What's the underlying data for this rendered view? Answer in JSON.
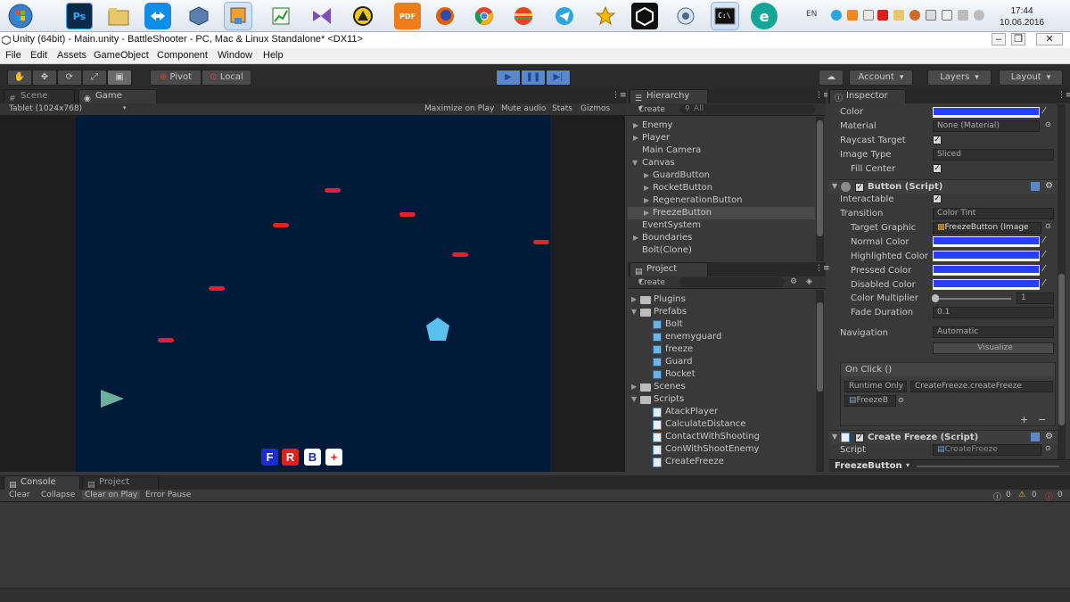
{
  "taskbar": {
    "apps": [
      {
        "name": "start-button",
        "label": ""
      },
      {
        "name": "photoshop",
        "label": "Ps"
      },
      {
        "name": "file-manager",
        "label": ""
      },
      {
        "name": "teamviewer",
        "label": ""
      },
      {
        "name": "virtualbox",
        "label": ""
      },
      {
        "name": "unity-hub",
        "label": ""
      },
      {
        "name": "editor-chart",
        "label": ""
      },
      {
        "name": "visual-studio",
        "label": ""
      },
      {
        "name": "archive",
        "label": ""
      },
      {
        "name": "pdf-tool",
        "label": "PDF"
      },
      {
        "name": "firefox",
        "label": ""
      },
      {
        "name": "chrome",
        "label": ""
      },
      {
        "name": "color-app",
        "label": ""
      },
      {
        "name": "telegram",
        "label": ""
      },
      {
        "name": "star-app",
        "label": ""
      },
      {
        "name": "unity",
        "label": ""
      },
      {
        "name": "remote-desktop",
        "label": ""
      },
      {
        "name": "command-prompt",
        "label": ""
      },
      {
        "name": "eset",
        "label": "e"
      }
    ],
    "tray_lang": "EN",
    "clock_time": "17:44",
    "clock_date": "10.06.2016"
  },
  "window": {
    "title": "Unity (64bit) - Main.unity - BattleShooter - PC, Mac & Linux Standalone* <DX11>"
  },
  "menu": [
    "File",
    "Edit",
    "Assets",
    "GameObject",
    "Component",
    "Window",
    "Help"
  ],
  "toolbar": {
    "pivot": "Pivot",
    "local": "Local",
    "account": "Account",
    "layers": "Layers",
    "layout": "Layout"
  },
  "scene_tabs": {
    "scene": "Scene",
    "game": "Game",
    "resolution": "Tablet (1024x768)",
    "maximize": "Maximize on Play",
    "mute": "Mute audio",
    "stats": "Stats",
    "gizmos": "Gizmos"
  },
  "game": {
    "buttons": [
      {
        "label": "F",
        "bg": "#1a2bd8",
        "fg": "#ffffff"
      },
      {
        "label": "R",
        "bg": "#e0201a",
        "fg": "#ffffff"
      },
      {
        "label": "B",
        "bg": "#ffffff",
        "fg": "#1a2b8a"
      },
      {
        "label": "+",
        "bg": "#ffffff",
        "fg": "#e0201a"
      }
    ]
  },
  "hierarchy": {
    "tab": "Hierarchy",
    "create": "Create",
    "search_placeholder": "All",
    "items": [
      {
        "label": "Enemy",
        "indent": 0,
        "arrow": true
      },
      {
        "label": "Player",
        "indent": 0,
        "arrow": true
      },
      {
        "label": "Main Camera",
        "indent": 0,
        "arrow": false
      },
      {
        "label": "Canvas",
        "indent": 0,
        "arrow": true,
        "open": true
      },
      {
        "label": "GuardButton",
        "indent": 1,
        "arrow": true
      },
      {
        "label": "RocketButton",
        "indent": 1,
        "arrow": true
      },
      {
        "label": "RegenerationButton",
        "indent": 1,
        "arrow": true
      },
      {
        "label": "FreezeButton",
        "indent": 1,
        "arrow": true,
        "selected": true
      },
      {
        "label": "EventSystem",
        "indent": 0,
        "arrow": false
      },
      {
        "label": "Boundaries",
        "indent": 0,
        "arrow": true
      },
      {
        "label": "Bolt(Clone)",
        "indent": 0,
        "arrow": false
      }
    ]
  },
  "project": {
    "tab": "Project",
    "create": "Create",
    "items": [
      {
        "label": "Plugins",
        "type": "folder",
        "indent": 0
      },
      {
        "label": "Prefabs",
        "type": "folder",
        "indent": 0,
        "open": true
      },
      {
        "label": "Bolt",
        "type": "prefab",
        "indent": 1
      },
      {
        "label": "enemyguard",
        "type": "prefab",
        "indent": 1
      },
      {
        "label": "freeze",
        "type": "prefab",
        "indent": 1
      },
      {
        "label": "Guard",
        "type": "prefab",
        "indent": 1
      },
      {
        "label": "Rocket",
        "type": "prefab",
        "indent": 1
      },
      {
        "label": "Scenes",
        "type": "folder",
        "indent": 0
      },
      {
        "label": "Scripts",
        "type": "folder",
        "indent": 0,
        "open": true
      },
      {
        "label": "AtackPlayer",
        "type": "script",
        "indent": 1
      },
      {
        "label": "CalculateDistance",
        "type": "script",
        "indent": 1
      },
      {
        "label": "ContactWithShooting",
        "type": "script",
        "indent": 1
      },
      {
        "label": "ConWithShootEnemy",
        "type": "script",
        "indent": 1
      },
      {
        "label": "CreateFreeze",
        "type": "script",
        "indent": 1
      }
    ]
  },
  "inspector": {
    "tab": "Inspector",
    "color_label": "Color",
    "material_label": "Material",
    "material_value": "None (Material)",
    "raycast_label": "Raycast Target",
    "image_type_label": "Image Type",
    "image_type_value": "Sliced",
    "fill_center_label": "Fill Center",
    "button_header": "Button (Script)",
    "interactable_label": "Interactable",
    "transition_label": "Transition",
    "transition_value": "Color Tint",
    "target_graphic_label": "Target Graphic",
    "target_graphic_value": "FreezeButton (Image",
    "normal_color_label": "Normal Color",
    "highlighted_color_label": "Highlighted Color",
    "pressed_color_label": "Pressed Color",
    "disabled_color_label": "Disabled Color",
    "color_multiplier_label": "Color Multiplier",
    "color_multiplier_value": "1",
    "fade_duration_label": "Fade Duration",
    "fade_duration_value": "0.1",
    "navigation_label": "Navigation",
    "navigation_value": "Automatic",
    "visualize_label": "Visualize",
    "onclick_label": "On Click ()",
    "runtime_value": "Runtime Only",
    "function_value": "CreateFreeze.createFreeze",
    "object_value": "FreezeB",
    "plus": "+",
    "minus": "−",
    "create_freeze_header": "Create Freeze (Script)",
    "script_label": "Script",
    "script_value": "CreateFreeze",
    "footer": "FreezeButton",
    "accent_color": "#2740ff"
  },
  "console": {
    "console_tab": "Console",
    "project_tab": "Project",
    "clear": "Clear",
    "collapse": "Collapse",
    "clear_on_play": "Clear on Play",
    "error_pause": "Error Pause",
    "info_count": "0",
    "warn_count": "0",
    "error_count": "0"
  }
}
